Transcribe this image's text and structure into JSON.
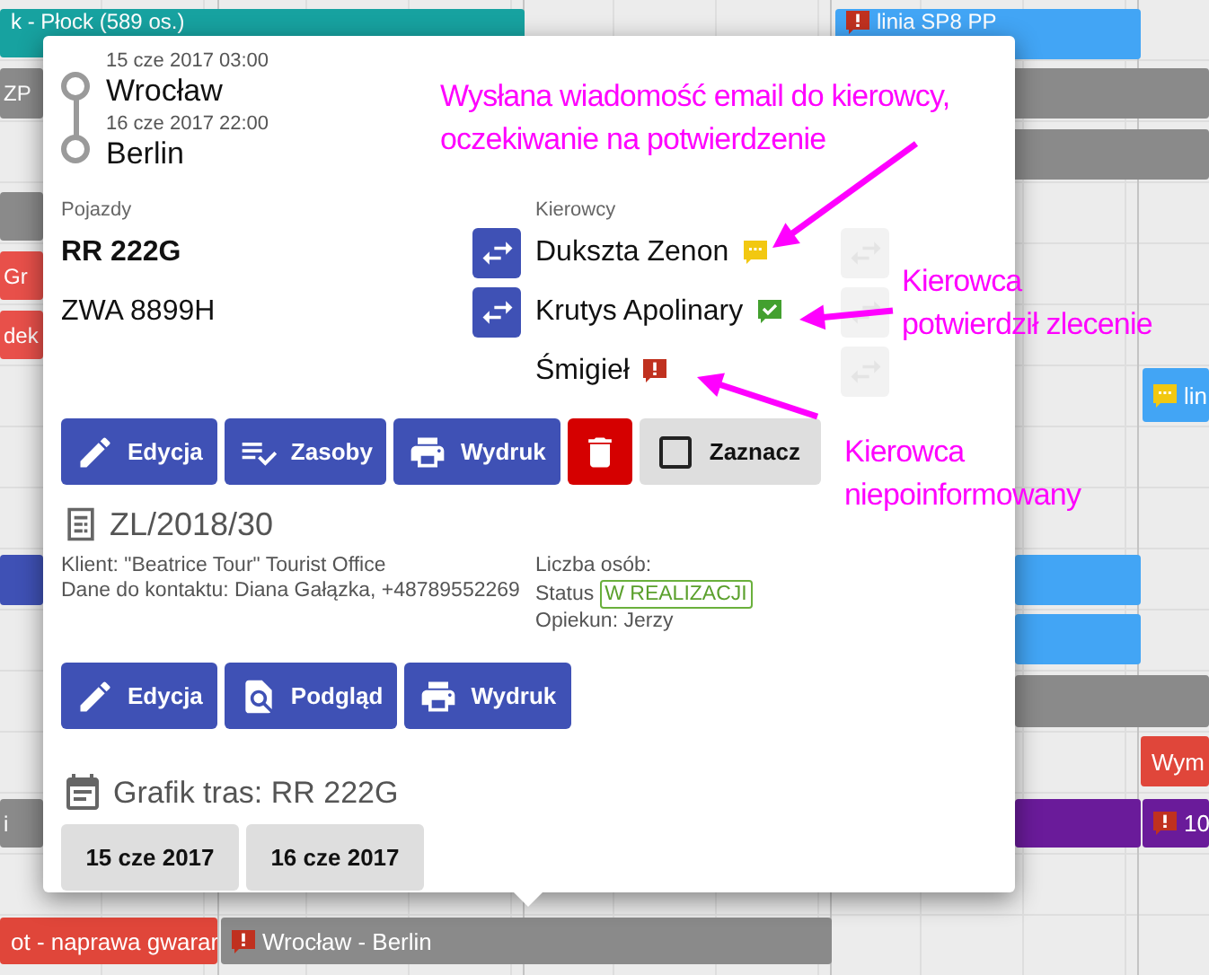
{
  "timeline": {
    "bars": [
      {
        "text": "k - Płock (589 os.)",
        "color": "#17a2a0"
      },
      {
        "text": "linia SP8 PP",
        "color": "#42a5f5"
      },
      {
        "text": "ZP",
        "color": "#8a8a8a"
      },
      {
        "color": "#8a8a8a"
      },
      {
        "color": "#8a8a8a"
      },
      {
        "color": "#8a8a8a"
      },
      {
        "text": "Gr",
        "color": "#e8504a"
      },
      {
        "text": "dek",
        "color": "#e8504a"
      },
      {
        "text": "lin",
        "color": "#42a5f5"
      },
      {
        "color": "#3f51b5"
      },
      {
        "color": "#42a5f5"
      },
      {
        "color": "#42a5f5"
      },
      {
        "color": "#8a8a8a"
      },
      {
        "text": "Wym",
        "color": "#e0463a"
      },
      {
        "text": "i",
        "color": "#8a8a8a"
      },
      {
        "color": "#6a1b9a"
      },
      {
        "text": "10",
        "color": "#6a1b9a"
      },
      {
        "text": "ot - naprawa gwarar",
        "color": "#e0463a"
      },
      {
        "text": "Wrocław - Berlin",
        "color": "#8a8a8a"
      }
    ]
  },
  "popup": {
    "route": [
      {
        "time": "15 cze 2017 03:00",
        "place": "Wrocław"
      },
      {
        "time": "16 cze 2017 22:00",
        "place": "Berlin"
      }
    ],
    "vehicles": {
      "label": "Pojazdy",
      "items": [
        {
          "plate": "RR 222G",
          "selected": true
        },
        {
          "plate": "ZWA 8899H",
          "selected": false
        }
      ]
    },
    "drivers": {
      "label": "Kierowcy",
      "items": [
        {
          "name": "Dukszta Zenon",
          "kind": "pending",
          "swap": true
        },
        {
          "name": "Krutys Apolinary",
          "kind": "confirmed",
          "swap": true
        },
        {
          "name": "Śmigieł",
          "kind": "not_informed",
          "swap": false
        }
      ]
    },
    "actions": [
      {
        "kind": "edit",
        "label": "Edycja"
      },
      {
        "kind": "resources",
        "label": "Zasoby"
      },
      {
        "kind": "print",
        "label": "Wydruk"
      },
      {
        "kind": "delete"
      },
      {
        "kind": "select",
        "label": "Zaznacz",
        "checked": false
      }
    ],
    "order": {
      "number": "ZL/2018/30",
      "client": "Klient: \"Beatrice Tour\" Tourist Office",
      "contact": "Dane do kontaktu: Diana Gałązka, +48789552269",
      "people": "Liczba osób:",
      "status_label": "Status",
      "status": "W REALIZACJI",
      "guardian": "Opiekun: Jerzy"
    },
    "order_actions": [
      {
        "kind": "edit",
        "label": "Edycja"
      },
      {
        "kind": "preview",
        "label": "Podgląd"
      },
      {
        "kind": "print",
        "label": "Wydruk"
      }
    ],
    "schedule": {
      "title": "Grafik tras: RR 222G",
      "dates": [
        "15 cze 2017",
        "16 cze 2017"
      ]
    }
  },
  "annotations": [
    {
      "lines": [
        "Wysłana wiadomość email do kierowcy,",
        "oczekiwanie na potwierdzenie"
      ]
    },
    {
      "lines": [
        "Kierowca",
        "potwierdził zlecenie"
      ]
    },
    {
      "lines": [
        "Kierowca",
        "niepoinformowany"
      ]
    }
  ]
}
